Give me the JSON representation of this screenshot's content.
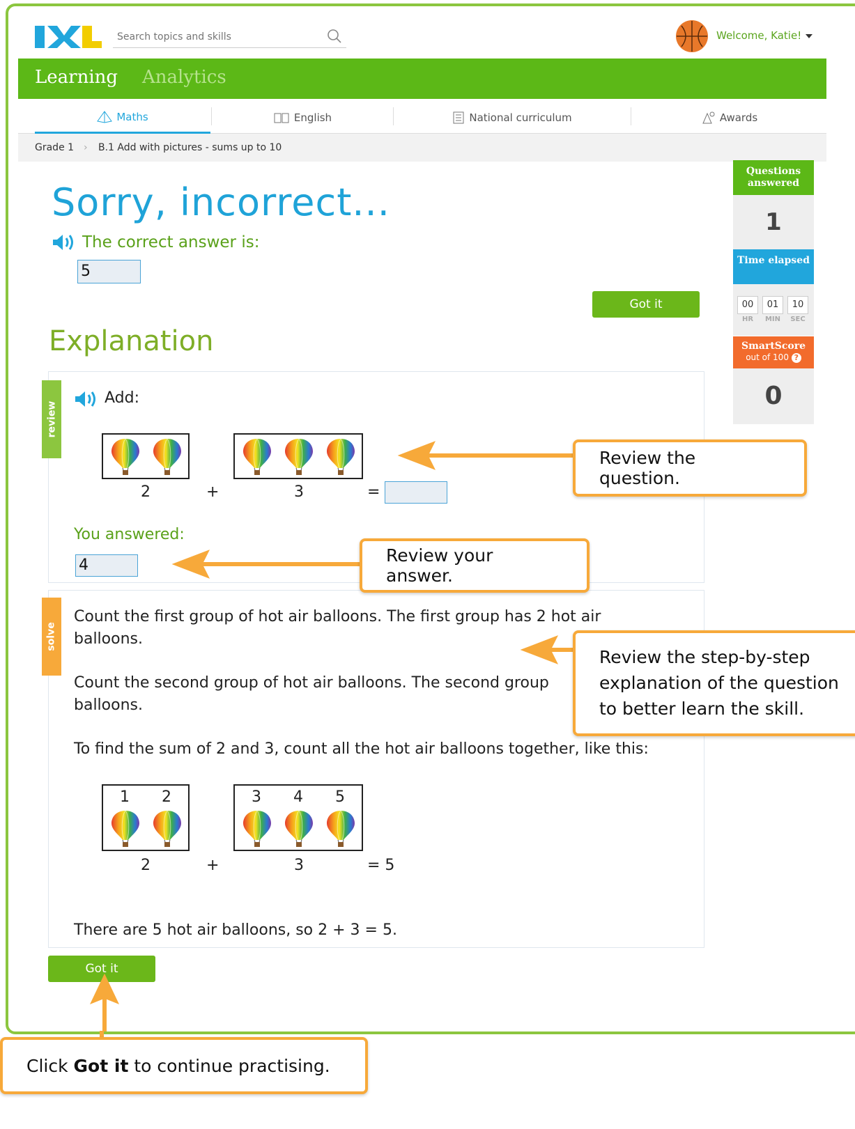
{
  "header": {
    "logo_text": "IXL",
    "search_placeholder": "Search topics and skills",
    "welcome": "Welcome, Katie!"
  },
  "nav": {
    "learning": "Learning",
    "analytics": "Analytics"
  },
  "tabs": [
    "Maths",
    "English",
    "National curriculum",
    "Awards"
  ],
  "breadcrumb": {
    "grade": "Grade 1",
    "skill": "B.1 Add with pictures - sums up to 10"
  },
  "feedback": {
    "title": "Sorry, incorrect...",
    "correct_label": "The correct answer is:",
    "correct_answer": "5",
    "got_it": "Got it"
  },
  "explanation": {
    "title": "Explanation",
    "review_flag": "review",
    "solve_flag": "solve",
    "add_label": "Add:",
    "group1_count": "2",
    "plus": "+",
    "group2_count": "3",
    "equals": "=",
    "you_answered_label": "You answered:",
    "your_answer": "4",
    "step1_a": "Count the first group of hot air balloons. The first group has 2 hot air",
    "step1_b": "balloons.",
    "step2_a": "Count the second group of hot air balloons. The second group",
    "step2_b": "balloons.",
    "step3": "To find the sum of 2 and 3, count all the hot air balloons together, like this:",
    "labels": [
      "1",
      "2",
      "3",
      "4",
      "5"
    ],
    "result": "= 5",
    "conclusion": "There are 5 hot air balloons, so 2 + 3 = 5.",
    "got_it": "Got it"
  },
  "sidebar": {
    "questions_label": "Questions answered",
    "questions_value": "1",
    "time_label": "Time elapsed",
    "hr": "00",
    "min": "01",
    "sec": "10",
    "hr_label": "HR",
    "min_label": "MIN",
    "sec_label": "SEC",
    "smartscore_label": "SmartScore",
    "smartscore_sub": "out of 100",
    "smartscore_value": "0"
  },
  "callouts": {
    "review_question": "Review the question.",
    "review_answer": "Review your answer.",
    "review_steps_1": "Review the step-by-step",
    "review_steps_2": "explanation of the question",
    "review_steps_3": "to better learn the skill.",
    "click_pre": "Click ",
    "click_bold": "Got it",
    "click_post": " to continue practising."
  },
  "colors": {
    "accent_green": "#5cb817",
    "blue": "#21a6dc",
    "orange": "#f7a93a",
    "smartscore": "#f26b2c"
  }
}
